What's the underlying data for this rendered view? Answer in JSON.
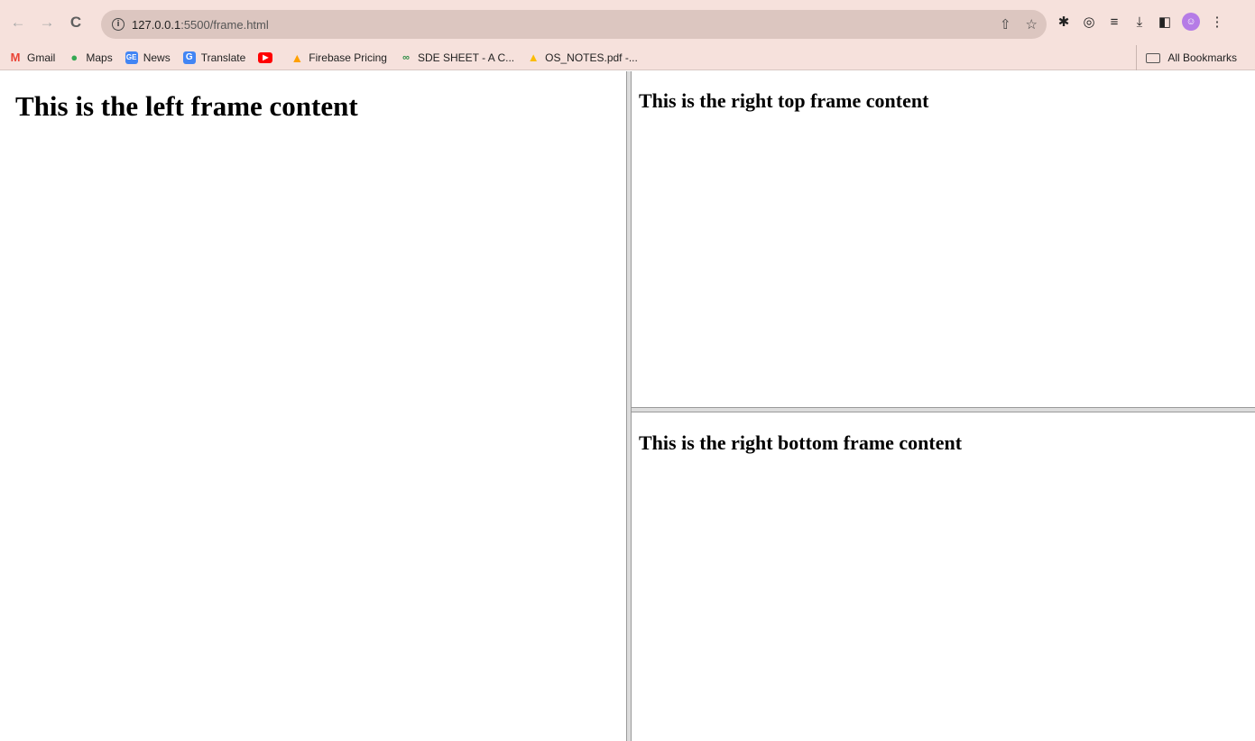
{
  "toolbar": {
    "url_host": "127.0.0.1",
    "url_path": ":5500/frame.html"
  },
  "bookmarks": [
    {
      "label": "Gmail",
      "icon": "gmail-icon",
      "color": "#ea4335"
    },
    {
      "label": "Maps",
      "icon": "maps-icon",
      "color": "#34a853"
    },
    {
      "label": "News",
      "icon": "news-icon",
      "color": "#4285f4"
    },
    {
      "label": "Translate",
      "icon": "translate-icon",
      "color": "#4285f4"
    },
    {
      "label": "",
      "icon": "youtube-icon",
      "color": "#ff0000"
    },
    {
      "label": "Firebase Pricing",
      "icon": "firebase-icon",
      "color": "#ffa000"
    },
    {
      "label": "SDE SHEET - A C...",
      "icon": "gfg-icon",
      "color": "#2f8d46"
    },
    {
      "label": "OS_NOTES.pdf -...",
      "icon": "drive-icon",
      "color": "#fbbc04"
    }
  ],
  "all_bookmarks_label": "All Bookmarks",
  "frames": {
    "left": "This is the left frame content",
    "right_top": "This is the right top frame content",
    "right_bottom": "This is the right bottom frame content"
  }
}
